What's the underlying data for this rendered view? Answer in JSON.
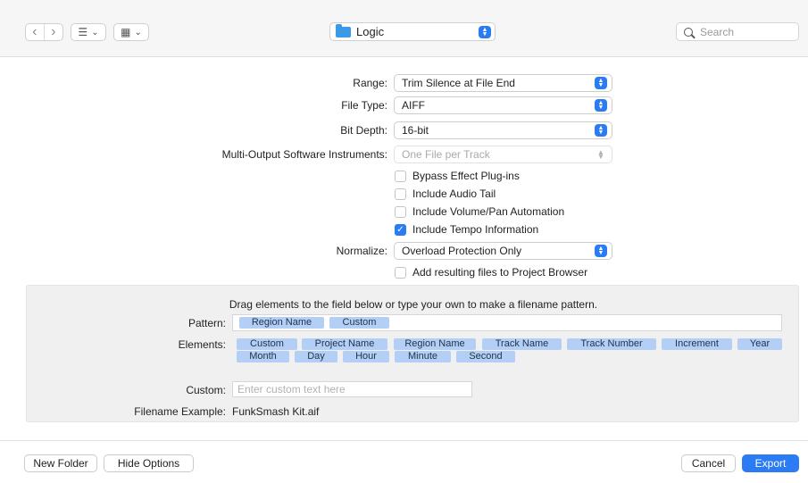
{
  "toolbar": {
    "back_glyph": "‹",
    "forward_glyph": "›",
    "list_view_glyph": "☰",
    "grid_view_glyph": "▦",
    "chevron_glyph": "⌄",
    "location": "Logic",
    "search_placeholder": "Search"
  },
  "options": {
    "range": {
      "label": "Range:",
      "value": "Trim Silence at File End"
    },
    "file_type": {
      "label": "File Type:",
      "value": "AIFF"
    },
    "bit_depth": {
      "label": "Bit Depth:",
      "value": "16-bit"
    },
    "multi_output": {
      "label": "Multi-Output Software Instruments:",
      "value": "One File per Track"
    },
    "checkboxes": [
      {
        "label": "Bypass Effect Plug-ins",
        "checked": false
      },
      {
        "label": "Include Audio Tail",
        "checked": false
      },
      {
        "label": "Include Volume/Pan Automation",
        "checked": false
      },
      {
        "label": "Include Tempo Information",
        "checked": true
      }
    ],
    "normalize": {
      "label": "Normalize:",
      "value": "Overload Protection Only"
    },
    "add_to_browser": {
      "label": "Add resulting files to Project Browser",
      "checked": false
    }
  },
  "filename": {
    "hint": "Drag elements to the field below or type your own to make a filename pattern.",
    "pattern_label": "Pattern:",
    "pattern_tokens": [
      "Region Name",
      "Custom"
    ],
    "elements_label": "Elements:",
    "elements_row1": [
      "Custom",
      "Project Name",
      "Region Name",
      "Track Name",
      "Track Number",
      "Increment",
      "Year"
    ],
    "elements_row2": [
      "Month",
      "Day",
      "Hour",
      "Minute",
      "Second"
    ],
    "custom_label": "Custom:",
    "custom_placeholder": "Enter custom text here",
    "example_label": "Filename Example:",
    "example_value": "FunkSmash Kit.aif"
  },
  "footer": {
    "new_folder": "New Folder",
    "hide_options": "Hide Options",
    "cancel": "Cancel",
    "export": "Export"
  },
  "colors": {
    "accent": "#2b7cf3",
    "token": "#b3cff6",
    "panel": "#f0f0f0"
  }
}
